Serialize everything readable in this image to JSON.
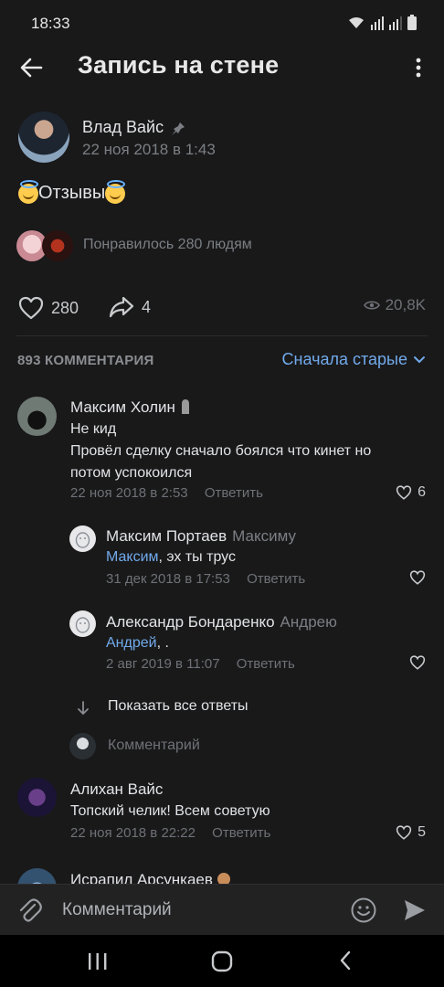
{
  "status_bar": {
    "time": "18:33"
  },
  "header": {
    "title": "Запись на стене"
  },
  "post": {
    "author": "Влад Вайс",
    "date": "22 ноя 2018 в 1:43",
    "text": "Отзывы",
    "liked_by": "Понравилось 280 людям",
    "likes": "280",
    "shares": "4",
    "views": "20,8K"
  },
  "comments_header": {
    "count": "893 КОММЕНТАРИЯ",
    "sort": "Сначала старые"
  },
  "comments": [
    {
      "name": "Максим Холин",
      "line1": "Не кид",
      "line2": "Провёл сделку сначало боялся что кинет но",
      "line3": "потом успокоился",
      "date": "22 ноя 2018 в 2:53",
      "reply": "Ответить",
      "likes": "6"
    },
    {
      "name": "Максим Портаев",
      "reply_to": "Максиму",
      "mention": "Максим",
      "text": ", эх ты трус",
      "date": "31 дек 2018 в 17:53",
      "reply": "Ответить"
    },
    {
      "name": "Александр Бондаренко",
      "reply_to": "Андрею",
      "mention": "Андрей",
      "text": ", .",
      "date": "2 авг 2019 в 11:07",
      "reply": "Ответить"
    },
    {
      "name": "Алихан Вайс",
      "text": "Топский челик!  Всем советую",
      "date": "22 ноя 2018 в 22:22",
      "reply": "Ответить",
      "likes": "5"
    },
    {
      "name": "Исрапил Арсункаев"
    }
  ],
  "thread": {
    "show_all": "Показать все ответы",
    "reply_placeholder": "Комментарий"
  },
  "composer": {
    "placeholder": "Комментарий"
  },
  "colors": {
    "accent": "#71aaeb",
    "background": "#19191a",
    "muted": "#6e7176"
  }
}
